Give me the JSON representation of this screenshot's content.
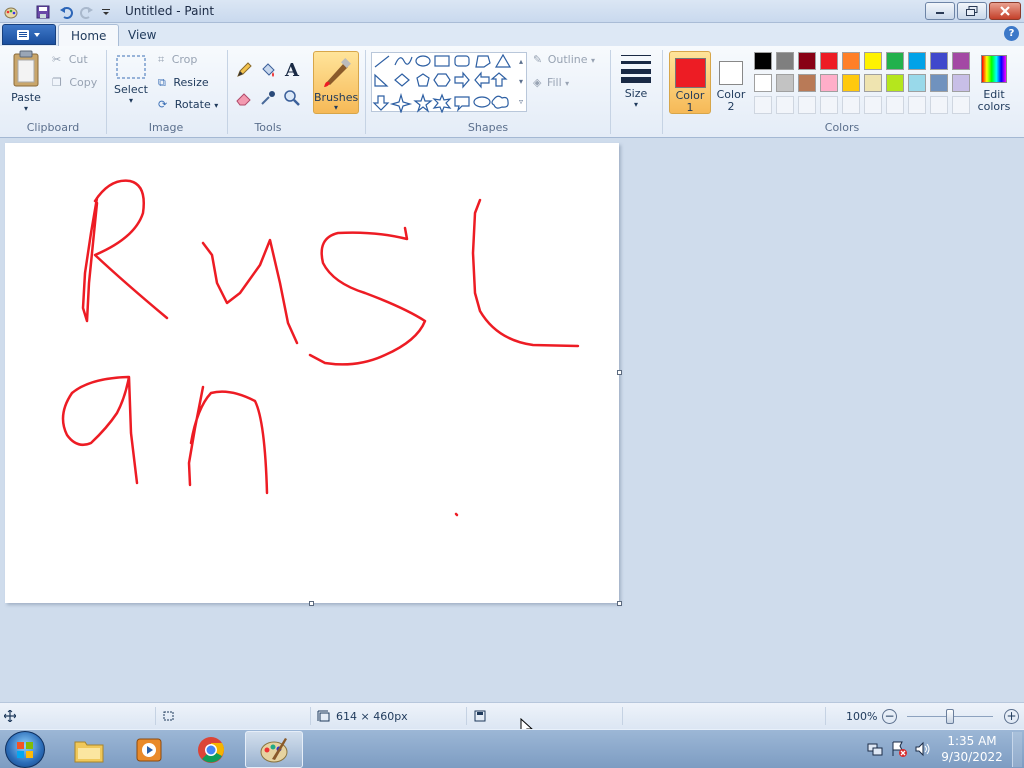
{
  "window": {
    "title": "Untitled - Paint"
  },
  "tabs": {
    "home": "Home",
    "view": "View"
  },
  "ribbon": {
    "clipboard": {
      "label": "Clipboard",
      "paste": "Paste",
      "cut": "Cut",
      "copy": "Copy"
    },
    "image": {
      "label": "Image",
      "select": "Select",
      "crop": "Crop",
      "resize": "Resize",
      "rotate": "Rotate"
    },
    "tools": {
      "label": "Tools"
    },
    "brushes": "Brushes",
    "shapes": {
      "label": "Shapes",
      "outline": "Outline",
      "fill": "Fill"
    },
    "size": "Size",
    "colors": {
      "label": "Colors",
      "color1_line1": "Color",
      "color1_line2": "1",
      "color2_line1": "Color",
      "color2_line2": "2",
      "edit_line1": "Edit",
      "edit_line2": "colors",
      "color1_value": "#ed1c24",
      "color2_value": "#ffffff",
      "palette_row1": [
        "#000000",
        "#7f7f7f",
        "#880015",
        "#ed1c24",
        "#ff7f27",
        "#fff200",
        "#22b14c",
        "#00a2e8",
        "#3f48cc",
        "#a349a4"
      ],
      "palette_row2": [
        "#ffffff",
        "#c3c3c3",
        "#b97a57",
        "#ffaec9",
        "#ffc90e",
        "#efe4b0",
        "#b5e61d",
        "#99d9ea",
        "#7092be",
        "#c8bfe7"
      ]
    }
  },
  "canvas": {
    "drawing_text": "Ruslan",
    "stroke_color": "#ed1c24"
  },
  "statusbar": {
    "dimensions": "614 × 460px",
    "zoom": "100%"
  },
  "taskbar": {
    "time": "1:35 AM",
    "date": "9/30/2022",
    "apps": [
      "windows-explorer",
      "media-player",
      "chrome",
      "paint"
    ]
  }
}
